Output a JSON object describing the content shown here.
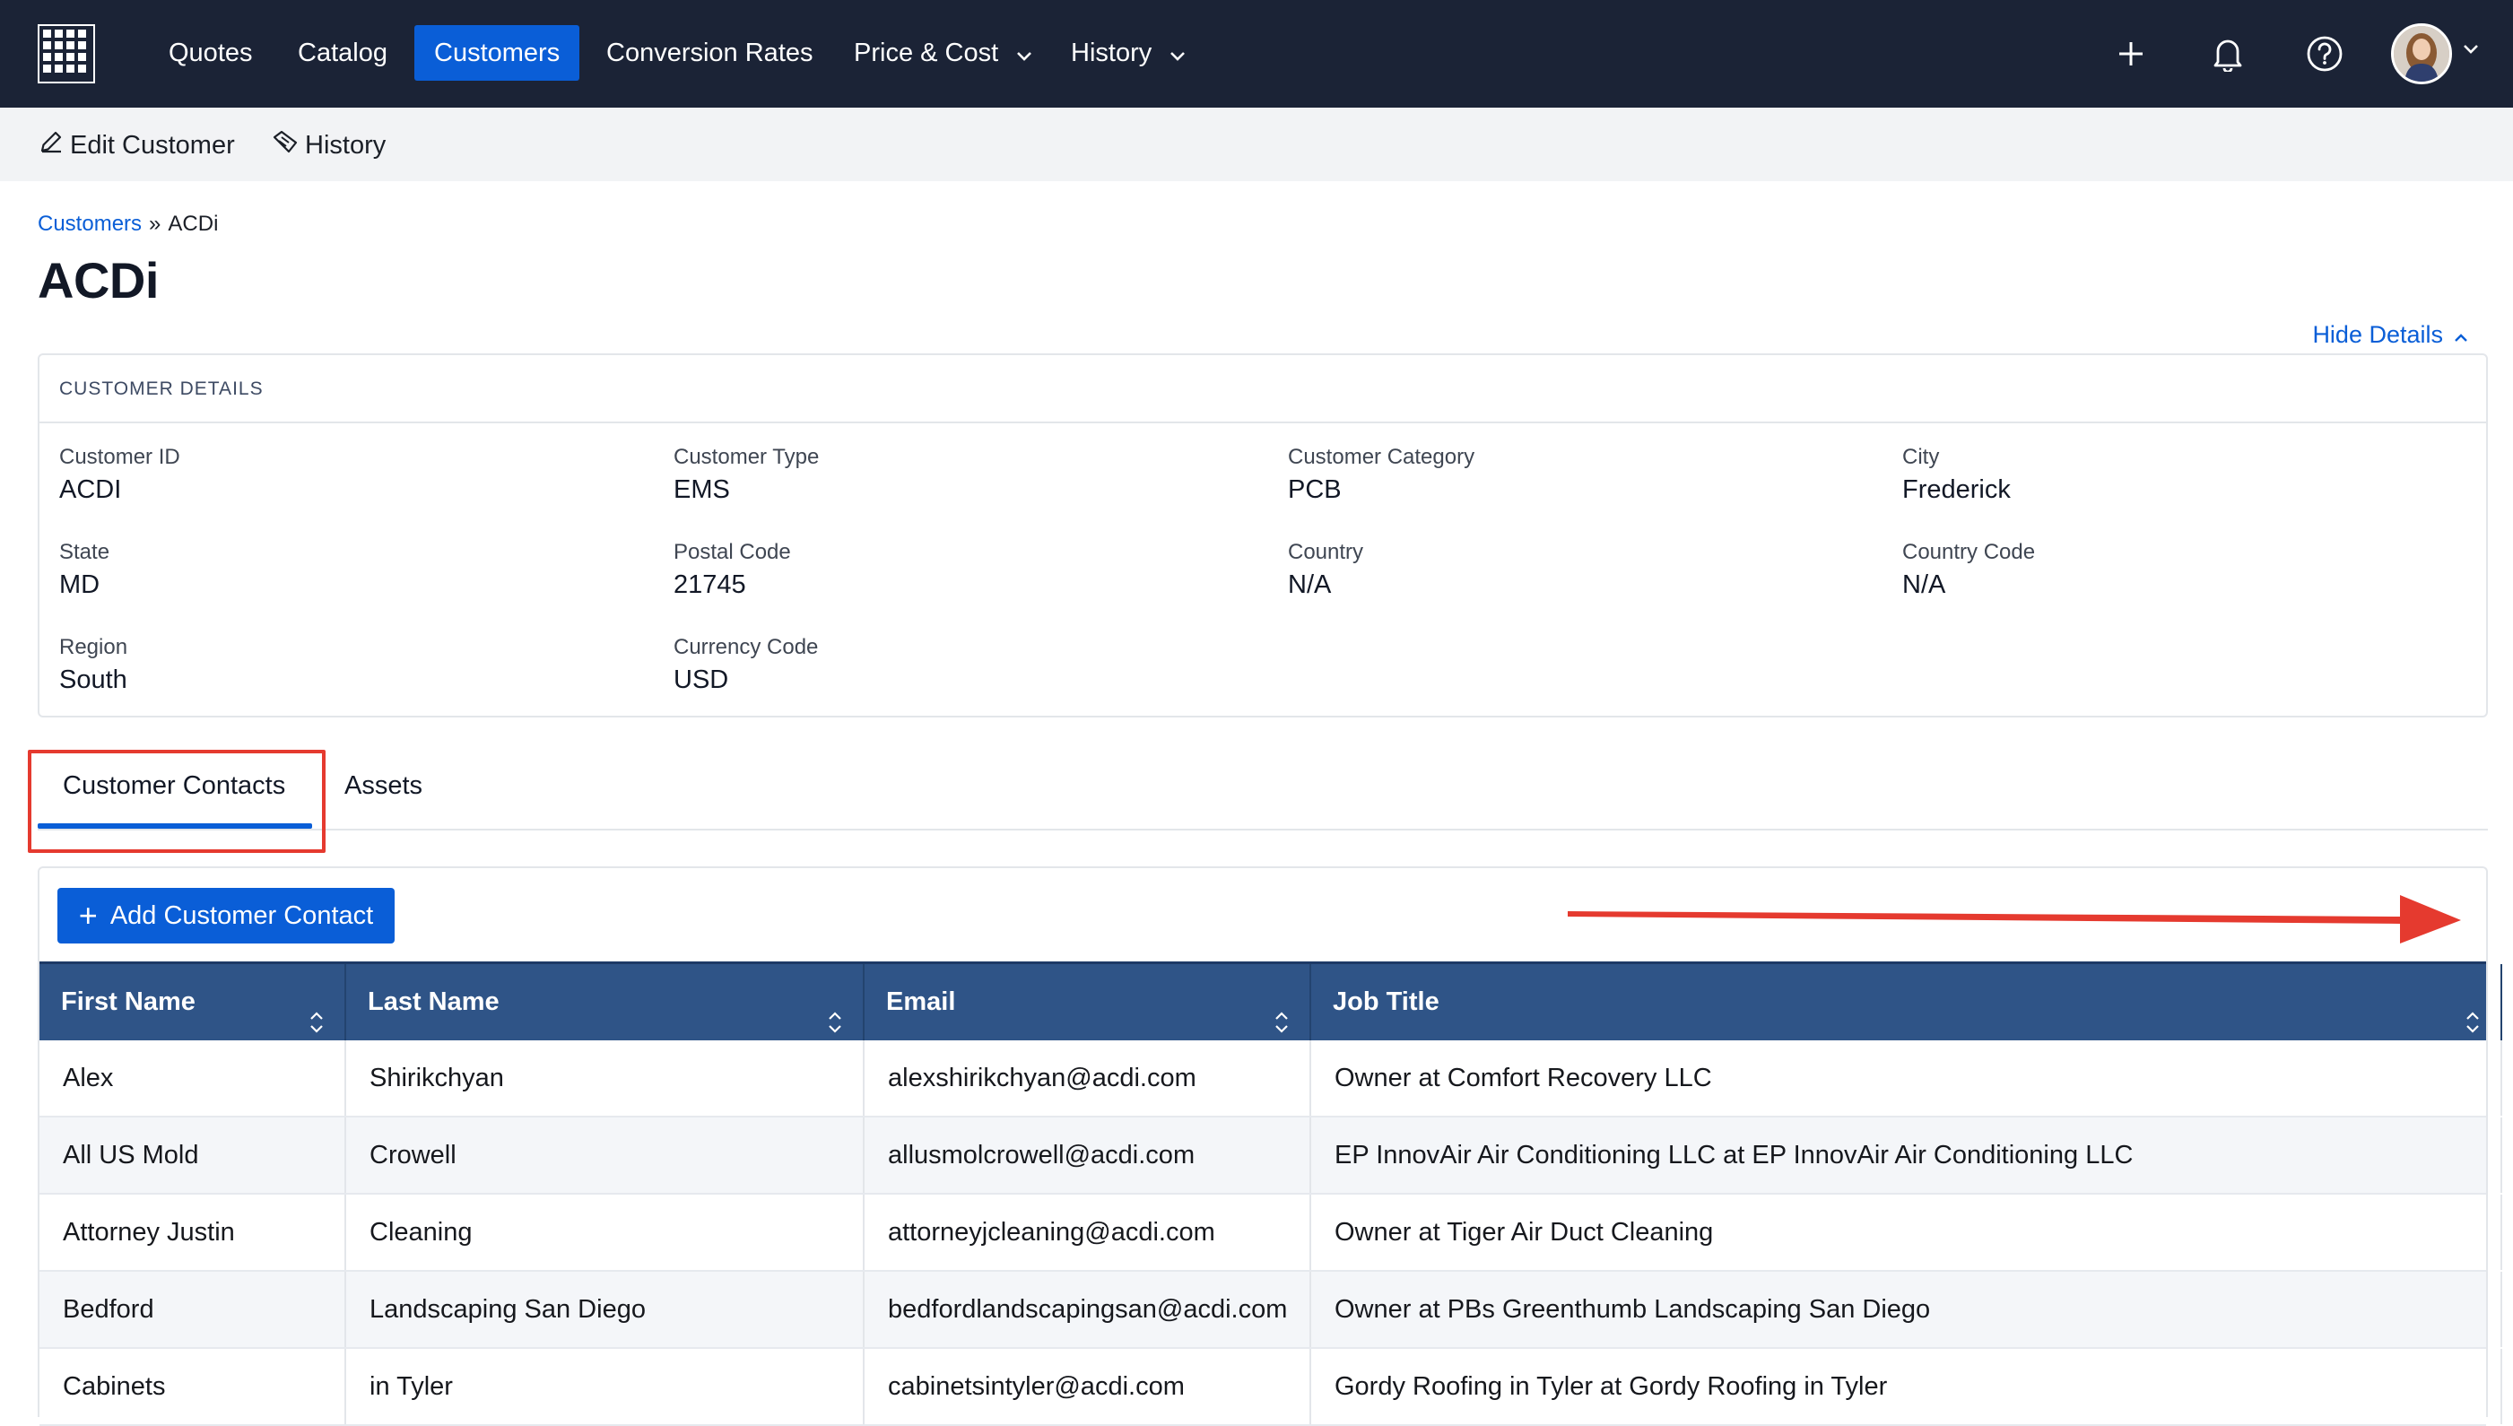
{
  "nav": {
    "logo_icon": "grid-logo-icon",
    "items": [
      {
        "label": "Quotes"
      },
      {
        "label": "Catalog"
      },
      {
        "label": "Customers",
        "active": true
      },
      {
        "label": "Conversion Rates"
      },
      {
        "label": "Price & Cost",
        "dropdown": true
      },
      {
        "label": "History",
        "dropdown": true
      }
    ],
    "icons": [
      "plus-icon",
      "bell-icon",
      "help-icon"
    ],
    "colors": {
      "background": "#1b2336",
      "active": "#0a5ed7"
    }
  },
  "toolbar": {
    "edit_label": "Edit Customer",
    "history_label": "History"
  },
  "breadcrumb": {
    "root": "Customers",
    "separator": "»",
    "current": "ACDi"
  },
  "page": {
    "title": "ACDi",
    "hide_details": "Hide Details"
  },
  "details": {
    "header": "CUSTOMER DETAILS",
    "fields": [
      {
        "label": "Customer ID",
        "value": "ACDI"
      },
      {
        "label": "Customer Type",
        "value": "EMS"
      },
      {
        "label": "Customer Category",
        "value": "PCB"
      },
      {
        "label": "City",
        "value": "Frederick"
      },
      {
        "label": "State",
        "value": "MD"
      },
      {
        "label": "Postal Code",
        "value": "21745"
      },
      {
        "label": "Country",
        "value": "N/A"
      },
      {
        "label": "Country Code",
        "value": "N/A"
      },
      {
        "label": "Region",
        "value": "South"
      },
      {
        "label": "Currency Code",
        "value": "USD"
      }
    ]
  },
  "tabs": [
    {
      "label": "Customer Contacts",
      "active": true
    },
    {
      "label": "Assets"
    }
  ],
  "contacts": {
    "add_label": "Add Customer Contact",
    "columns": [
      "First Name",
      "Last Name",
      "Email",
      "Job Title"
    ],
    "rows": [
      [
        "Alex",
        "Shirikchyan",
        "alexshirikchyan@acdi.com",
        "Owner at Comfort Recovery LLC"
      ],
      [
        "All US Mold",
        "Crowell",
        "allusmolcrowell@acdi.com",
        "EP InnovAir Air Conditioning LLC at EP InnovAir Air Conditioning LLC"
      ],
      [
        "Attorney Justin",
        "Cleaning",
        "attorneyjcleaning@acdi.com",
        "Owner at Tiger Air Duct Cleaning"
      ],
      [
        "Bedford",
        "Landscaping San Diego",
        "bedfordlandscapingsan@acdi.com",
        "Owner at PBs Greenthumb Landscaping San Diego"
      ],
      [
        "Cabinets",
        "in Tyler",
        "cabinetsintyler@acdi.com",
        "Gordy Roofing in Tyler at Gordy Roofing in Tyler"
      ]
    ]
  },
  "annotations": {
    "highlight_color": "#e53a2f"
  }
}
